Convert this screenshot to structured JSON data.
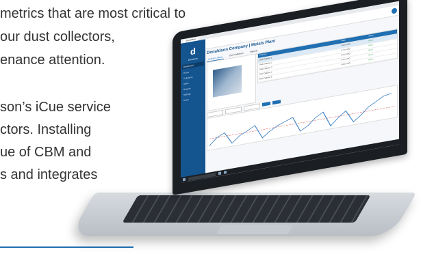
{
  "article": {
    "lines": [
      "metrics that are most critical to",
      "our dust collectors,",
      "enance attention.",
      "son’s iCue service",
      "ctors. Installing",
      "ue of CBM and",
      "s and integrates"
    ]
  },
  "app": {
    "brand": "Donaldson",
    "page_title": "Donaldson Company | Metals Plant",
    "sidebar_button": "Dashboard",
    "sidebar_items": [
      "Home",
      "Collectors",
      "Alerts",
      "Reports",
      "Settings",
      "Users"
    ],
    "tabs": [
      "Collector Status",
      "Dust Collectors",
      "Reports"
    ],
    "table_headers": [
      "Collector",
      "Value",
      "Status"
    ],
    "table_rows": [
      [
        "Dust Collector 1",
        "0.5 in. H2O",
        "Good"
      ],
      [
        "Dust Collector 2",
        "0.7 in. H2O",
        "Good"
      ],
      [
        "Dust Collector 3",
        "0.6 in. H2O",
        "Good"
      ],
      [
        "Dust Collector 4",
        "0.4 in. H2O",
        "Good"
      ],
      [
        "Dust Collector 5",
        "0.8 in. H2O",
        "Good"
      ]
    ],
    "taskbar_search": "Type here to search"
  },
  "colors": {
    "accent": "#1f6fb2",
    "sidebar": "#14548f",
    "good": "#2a9d46",
    "chart_line": "#3b82c4",
    "chart_alarm": "#d9534f"
  }
}
